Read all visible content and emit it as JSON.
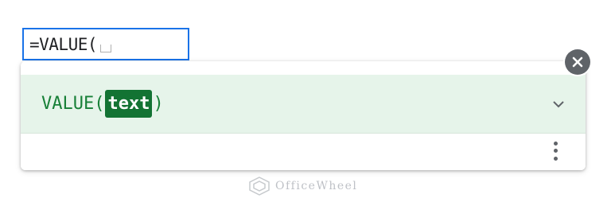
{
  "cell_editor": {
    "formula_text": "=VALUE("
  },
  "formula_help": {
    "function_name": "VALUE",
    "open_paren": "(",
    "parameter": "text",
    "close_paren": ")",
    "expand_icon": "chevron-down-icon",
    "more_icon": "more-vert-icon",
    "close_icon": "close-icon"
  },
  "watermark": {
    "text": "OfficeWheel"
  },
  "colors": {
    "cell_border": "#1a73e8",
    "signature_bg": "#e6f4ea",
    "signature_text": "#188038",
    "parameter_bg": "#137333",
    "icon_gray": "#5f6368"
  }
}
